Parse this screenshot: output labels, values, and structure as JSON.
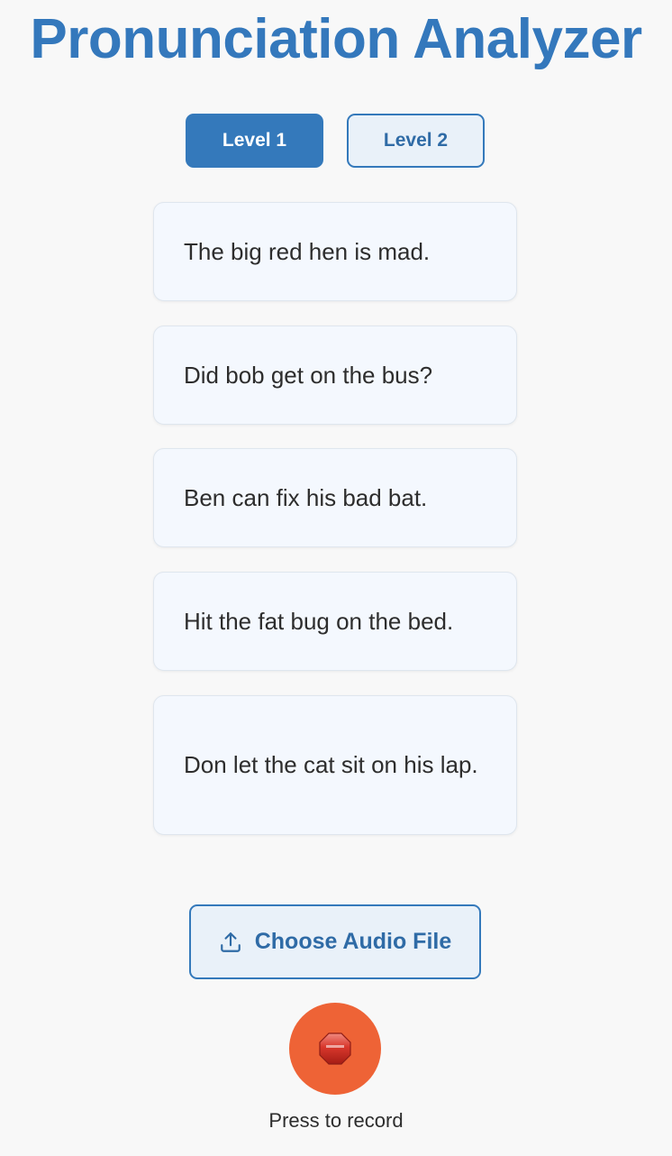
{
  "title": "Pronunciation Analyzer",
  "levels": [
    {
      "label": "Level 1",
      "selected": true
    },
    {
      "label": "Level 2",
      "selected": false
    }
  ],
  "sentences": [
    "The big red hen is mad.",
    "Did bob get on the bus?",
    "Ben can fix his bad bat.",
    "Hit the fat bug on the bed.",
    "Don let the cat sit on his lap."
  ],
  "upload": {
    "label": "Choose Audio File",
    "icon": "upload-icon"
  },
  "record": {
    "icon": "stop-sign-icon",
    "label": "Press to record"
  },
  "colors": {
    "accent": "#3479bb",
    "record": "#ee6336",
    "card_bg": "#f4f8fe",
    "page_bg": "#f8f8f8"
  }
}
